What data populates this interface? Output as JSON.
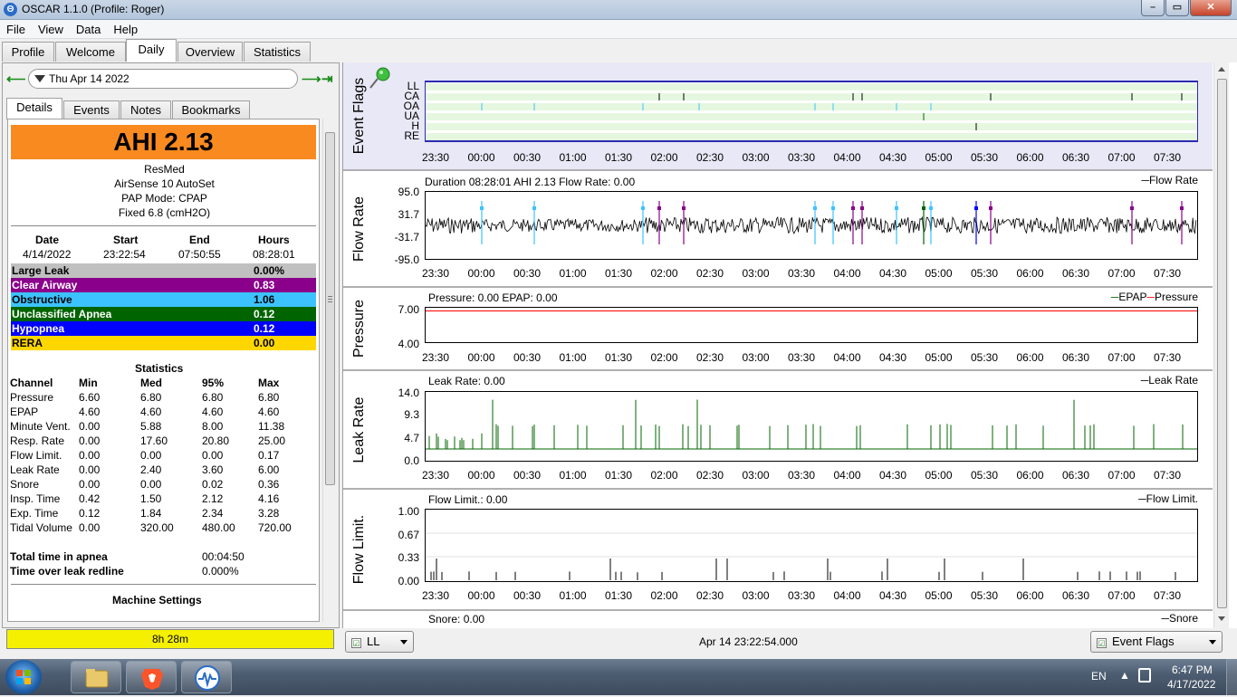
{
  "window": {
    "title": "OSCAR 1.1.0 (Profile: Roger)",
    "app_icon": "Θ"
  },
  "menu": [
    "File",
    "View",
    "Data",
    "Help"
  ],
  "main_tabs": [
    "Profile",
    "Welcome",
    "Daily",
    "Overview",
    "Statistics"
  ],
  "date": {
    "value": "Thu Apr 14 2022"
  },
  "sub_tabs": [
    "Details",
    "Events",
    "Notes",
    "Bookmarks"
  ],
  "details": {
    "ahi": "AHI 2.13",
    "machine": [
      "ResMed",
      "AirSense 10 AutoSet",
      "PAP Mode: CPAP",
      "Fixed 6.8 (cmH2O)"
    ],
    "session_headers": [
      "Date",
      "Start",
      "End",
      "Hours"
    ],
    "session_values": [
      "4/14/2022",
      "23:22:54",
      "07:50:55",
      "08:28:01"
    ],
    "events": [
      {
        "name": "Large Leak",
        "value": "0.00%",
        "color": "#c0c0c0",
        "text": "#000000"
      },
      {
        "name": "Clear Airway",
        "value": "0.83",
        "color": "#8b008b",
        "text": "#ffffff"
      },
      {
        "name": "Obstructive",
        "value": "1.06",
        "color": "#3cc3ff",
        "text": "#000000"
      },
      {
        "name": "Unclassified Apnea",
        "value": "0.12",
        "color": "#006400",
        "text": "#ffffff"
      },
      {
        "name": "Hypopnea",
        "value": "0.12",
        "color": "#0000ff",
        "text": "#ffffff"
      },
      {
        "name": "RERA",
        "value": "0.00",
        "color": "#ffd700",
        "text": "#000000"
      }
    ],
    "statistics_title": "Statistics",
    "stat_headers": [
      "Channel",
      "Min",
      "Med",
      "95%",
      "Max"
    ],
    "stats": [
      [
        "Pressure",
        "6.60",
        "6.80",
        "6.80",
        "6.80"
      ],
      [
        "EPAP",
        "4.60",
        "4.60",
        "4.60",
        "4.60"
      ],
      [
        "Minute Vent.",
        "0.00",
        "5.88",
        "8.00",
        "11.38"
      ],
      [
        "Resp. Rate",
        "0.00",
        "17.60",
        "20.80",
        "25.00"
      ],
      [
        "Flow Limit.",
        "0.00",
        "0.00",
        "0.00",
        "0.17"
      ],
      [
        "Leak Rate",
        "0.00",
        "2.40",
        "3.60",
        "6.00"
      ],
      [
        "Snore",
        "0.00",
        "0.00",
        "0.02",
        "0.36"
      ],
      [
        "Insp. Time",
        "0.42",
        "1.50",
        "2.12",
        "4.16"
      ],
      [
        "Exp. Time",
        "0.12",
        "1.84",
        "2.34",
        "3.28"
      ],
      [
        "Tidal Volume",
        "0.00",
        "320.00",
        "480.00",
        "720.00"
      ]
    ],
    "apnea_label": "Total time in apnea",
    "apnea_value": "00:04:50",
    "leak_label": "Time over leak redline",
    "leak_value": "0.000%",
    "machine_settings": "Machine Settings"
  },
  "duration_bar": "8h 28m",
  "x_ticks": [
    "23:30",
    "00:00",
    "00:30",
    "01:00",
    "01:30",
    "02:00",
    "02:30",
    "03:00",
    "03:30",
    "04:00",
    "04:30",
    "05:00",
    "05:30",
    "06:00",
    "06:30",
    "07:00",
    "07:30"
  ],
  "graphs": {
    "event_flags": {
      "label": "Event Flags",
      "rows": [
        "LL",
        "CA",
        "OA",
        "UA",
        "H",
        "RE"
      ]
    },
    "flow_rate": {
      "label": "Flow Rate",
      "title": "Duration 08:28:01 AHI 2.13 Flow Rate: 0.00",
      "legend": "Flow Rate",
      "ticks": [
        "95.0",
        "31.7",
        "-31.7",
        "-95.0"
      ]
    },
    "pressure": {
      "label": "Pressure",
      "title": "Pressure: 0.00 EPAP: 0.00",
      "legend_epap": "EPAP",
      "legend_pressure": "Pressure",
      "ticks": [
        "7.00",
        "4.00"
      ]
    },
    "leak_rate": {
      "label": "Leak Rate",
      "title": "Leak Rate: 0.00",
      "legend": "Leak Rate",
      "ticks": [
        "14.0",
        "9.3",
        "4.7",
        "0.0"
      ]
    },
    "flow_limit": {
      "label": "Flow Limit.",
      "title": "Flow Limit.: 0.00",
      "legend": "Flow Limit.",
      "ticks": [
        "1.00",
        "0.67",
        "0.33",
        "0.00"
      ]
    },
    "snore": {
      "title": "Snore: 0.00",
      "legend": "Snore"
    }
  },
  "bottom": {
    "left_combo": "LL",
    "timestamp": "Apr 14 23:22:54.000",
    "right_combo": "Event Flags"
  },
  "taskbar": {
    "lang": "EN",
    "time": "6:47 PM",
    "date": "4/17/2022"
  },
  "colors": {
    "orange": "#f98a20",
    "flow": "#000000",
    "leak": "#006400",
    "epap": "#006400",
    "pressure": "#ff0000",
    "panel_bg": "#e8e8f6"
  }
}
